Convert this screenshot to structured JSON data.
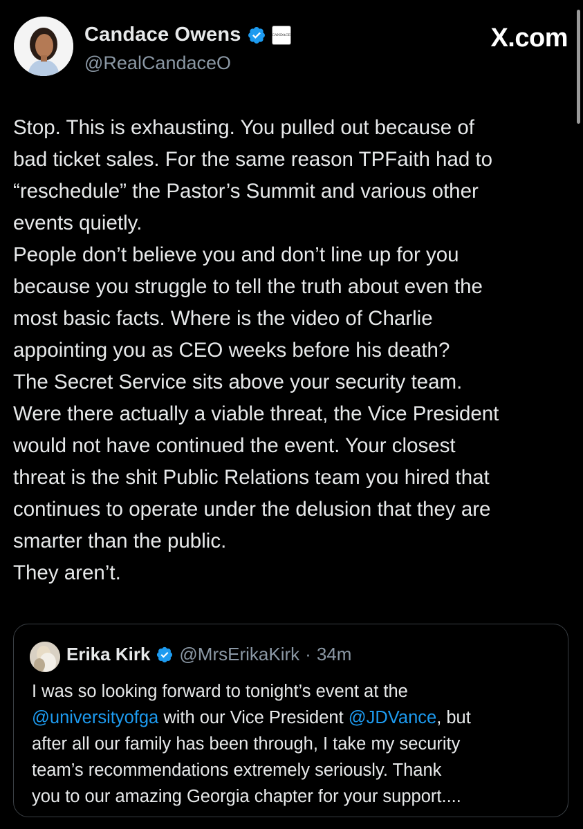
{
  "brand": {
    "label": "X.com"
  },
  "author": {
    "name": "Candace Owens",
    "handle": "@RealCandaceO",
    "affiliate_badge_text": "CANDACE"
  },
  "tweet": {
    "lines": [
      "Stop. This is exhausting. You pulled out because of",
      "bad ticket sales. For the same reason TPFaith had to",
      "“reschedule” the Pastor’s Summit and various other",
      "events quietly.",
      "People don’t believe you and don’t line up for you",
      "because you struggle to tell the truth about even the",
      "most basic facts. Where is the video of Charlie",
      "appointing you as CEO weeks before his death?",
      "The Secret Service sits above your security team.",
      "Were there actually a viable threat, the Vice President",
      "would not have continued the event. Your closest",
      "threat is the shit Public Relations team you hired that",
      "continues to operate under the delusion that they are",
      "smarter than the public.",
      "They aren’t."
    ]
  },
  "quote": {
    "name": "Erika Kirk",
    "handle": "@MrsErikaKirk",
    "separator": "·",
    "time": "34m",
    "line1": "I was so looking forward to tonight’s event at the",
    "line2_mention1": "@universityofga",
    "line2_mid": " with our Vice President ",
    "line2_mention2": "@JDVance",
    "line2_end": ", but",
    "line3": "after all our family has been through, I take my security",
    "line4": "team’s recommendations extremely seriously. Thank",
    "line5": "you to our amazing Georgia chapter for your support...."
  },
  "colors": {
    "background": "#000000",
    "text": "#e7e9ea",
    "secondary_text": "#8b98a5",
    "link": "#1d9bf0",
    "verified": "#1d9bf0",
    "border": "#3a3f44"
  },
  "icons": {
    "verified": "verified-badge-icon",
    "affiliate": "affiliate-badge-icon",
    "brand": "x-logo-icon"
  }
}
